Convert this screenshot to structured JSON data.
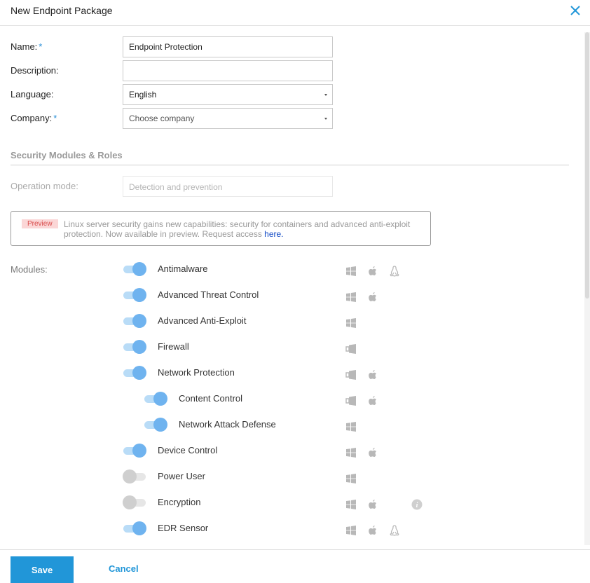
{
  "dialog": {
    "title": "New Endpoint Package"
  },
  "form": {
    "name_label": "Name:",
    "name_required": "*",
    "name_value": "Endpoint Protection",
    "description_label": "Description:",
    "description_value": "",
    "language_label": "Language:",
    "language_value": "English",
    "company_label": "Company:",
    "company_required": "*",
    "company_placeholder": "Choose company"
  },
  "section": {
    "title": "Security Modules & Roles"
  },
  "operation": {
    "label": "Operation mode:",
    "value": "Detection and prevention"
  },
  "notice": {
    "badge": "Preview",
    "text": "Linux server security gains new capabilities: security for containers and advanced anti-exploit protection. Now available in preview. Request access ",
    "link": "here."
  },
  "modules_label": "Modules:",
  "modules": [
    {
      "label": "Antimalware",
      "enabled": true,
      "indent": 0,
      "os": [
        "windows-icon",
        "apple-icon",
        "linux-icon"
      ]
    },
    {
      "label": "Advanced Threat Control",
      "enabled": true,
      "indent": 0,
      "os": [
        "windows-icon",
        "apple-icon"
      ]
    },
    {
      "label": "Advanced Anti-Exploit",
      "enabled": true,
      "indent": 0,
      "os": [
        "windows-icon"
      ]
    },
    {
      "label": "Firewall",
      "enabled": true,
      "indent": 0,
      "os": [
        "windows-legacy-icon"
      ]
    },
    {
      "label": "Network Protection",
      "enabled": true,
      "indent": 0,
      "os": [
        "windows-legacy-icon",
        "apple-icon"
      ]
    },
    {
      "label": "Content Control",
      "enabled": true,
      "indent": 1,
      "os": [
        "windows-legacy-icon",
        "apple-icon"
      ]
    },
    {
      "label": "Network Attack Defense",
      "enabled": true,
      "indent": 1,
      "os": [
        "windows-icon"
      ]
    },
    {
      "label": "Device Control",
      "enabled": true,
      "indent": 0,
      "os": [
        "windows-icon",
        "apple-icon"
      ]
    },
    {
      "label": "Power User",
      "enabled": false,
      "indent": 0,
      "os": [
        "windows-icon"
      ]
    },
    {
      "label": "Encryption",
      "enabled": false,
      "indent": 0,
      "os": [
        "windows-icon",
        "apple-icon"
      ],
      "info": true
    },
    {
      "label": "EDR Sensor",
      "enabled": true,
      "indent": 0,
      "os": [
        "windows-icon",
        "apple-icon",
        "linux-icon"
      ]
    }
  ],
  "footer": {
    "save_label": "Save",
    "cancel_label": "Cancel"
  },
  "colors": {
    "accent": "#2196d8",
    "toggle_on": "#6fb3ef",
    "toggle_off": "#cfcfcf",
    "icon_gray": "#b8b8b8"
  }
}
